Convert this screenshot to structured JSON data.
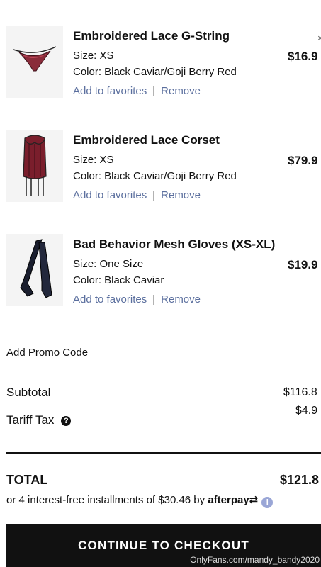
{
  "items": [
    {
      "name": "Embroidered Lace G-String",
      "size": "Size: XS",
      "color": "Color: Black Caviar/Goji Berry Red",
      "favorites": "Add to favorites",
      "separator": "|",
      "remove": "Remove",
      "price": "$16.9"
    },
    {
      "name": "Embroidered Lace Corset",
      "size": "Size: XS",
      "color": "Color: Black Caviar/Goji Berry Red",
      "favorites": "Add to favorites",
      "separator": "|",
      "remove": "Remove",
      "price": "$79.9"
    },
    {
      "name": "Bad Behavior Mesh Gloves (XS-XL)",
      "size": "Size: One Size",
      "color": "Color: Black Caviar",
      "favorites": "Add to favorites",
      "separator": "|",
      "remove": "Remove",
      "price": "$19.9"
    }
  ],
  "promo": {
    "label": "Add Promo Code"
  },
  "summary": {
    "subtotal_label": "Subtotal",
    "subtotal_value": "$116.8",
    "tax_label": "Tariff Tax",
    "tax_value": "$4.9",
    "total_label": "TOTAL",
    "total_value": "$121.8"
  },
  "afterpay": {
    "text": "or 4 interest-free installments of $30.46 by",
    "logo": "afterpay"
  },
  "checkout": {
    "label": "CONTINUE TO CHECKOUT"
  },
  "watermark": "OnlyFans.com/mandy_bandy2020"
}
